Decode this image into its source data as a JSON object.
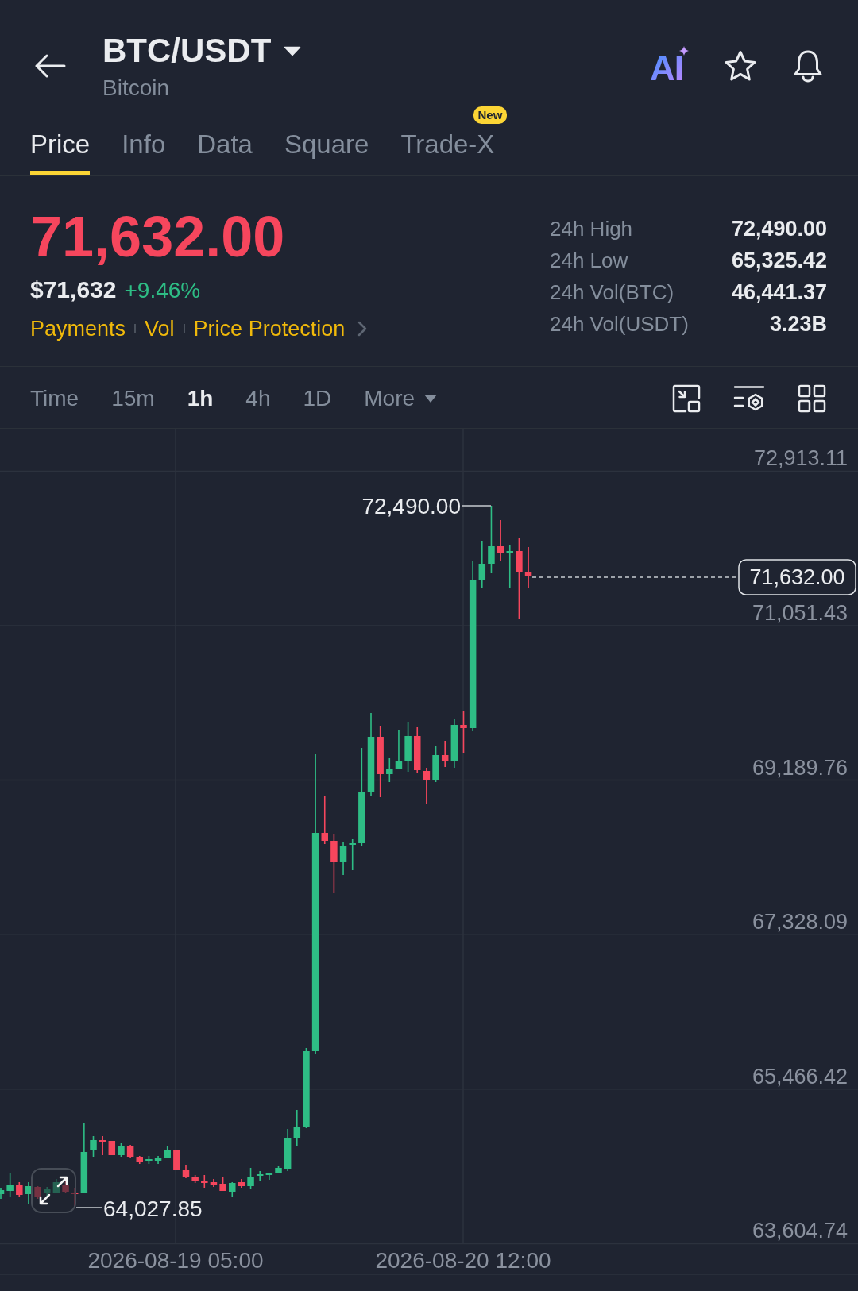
{
  "header": {
    "pair": "BTC/USDT",
    "name": "Bitcoin",
    "ai_label": "AI"
  },
  "tabs": [
    {
      "label": "Price",
      "selected": true
    },
    {
      "label": "Info",
      "selected": false
    },
    {
      "label": "Data",
      "selected": false
    },
    {
      "label": "Square",
      "selected": false
    },
    {
      "label": "Trade-X",
      "selected": false,
      "badge": "New"
    }
  ],
  "quote": {
    "last_price": "71,632.00",
    "price_down": true,
    "usd_price": "$71,632",
    "change": "+9.46%",
    "change_up": true,
    "links": [
      "Payments",
      "Vol",
      "Price Protection"
    ]
  },
  "stats": [
    {
      "label": "24h High",
      "value": "72,490.00"
    },
    {
      "label": "24h Low",
      "value": "65,325.42"
    },
    {
      "label": "24h Vol(BTC)",
      "value": "46,441.37"
    },
    {
      "label": "24h Vol(USDT)",
      "value": "3.23B"
    }
  ],
  "intervals": [
    {
      "label": "Time",
      "kind": "option",
      "selected": false
    },
    {
      "label": "15m",
      "kind": "option",
      "selected": false
    },
    {
      "label": "1h",
      "kind": "option",
      "selected": true
    },
    {
      "label": "4h",
      "kind": "option",
      "selected": false
    },
    {
      "label": "1D",
      "kind": "option",
      "selected": false
    },
    {
      "label": "More",
      "kind": "dropdown",
      "selected": false
    }
  ],
  "chart": {
    "price_ticks": [
      "72,913.11",
      "71,051.43",
      "69,189.76",
      "67,328.09",
      "65,466.42",
      "63,604.74"
    ],
    "time_ticks": [
      "2026-08-19 05:00",
      "2026-08-20 12:00"
    ],
    "high_marker": "72,490.00",
    "low_marker": "64,027.85",
    "last_price": "71,632.00"
  }
}
